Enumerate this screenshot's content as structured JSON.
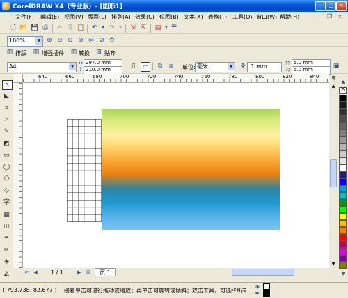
{
  "window": {
    "title": "CorelDRAW X4（专业版）- [图形1]"
  },
  "menu": [
    "文件(F)",
    "编辑(E)",
    "视图(V)",
    "版面(L)",
    "排列(A)",
    "效果(C)",
    "位图(B)",
    "文本(X)",
    "表格(T)",
    "工具(O)",
    "窗口(W)",
    "帮助(H)"
  ],
  "zoom": {
    "value": "100%"
  },
  "toolbar3": {
    "layout_label": "排版",
    "enhance_label": "增强插件",
    "convert_label": "转换",
    "align_label": "贴齐"
  },
  "property_bar": {
    "paper": "A4",
    "width": "297.0 mm",
    "height": "210.0 mm",
    "units_label": "单位:",
    "units_value": "毫米",
    "nudge": ".1 mm",
    "dup_x": "5.0 mm",
    "dup_y": "5.0 mm"
  },
  "ruler": {
    "h_ticks": [
      "640",
      "660",
      "680",
      "700",
      "720",
      "740",
      "760",
      "780",
      "800",
      "820",
      "840"
    ],
    "unit": "毫米"
  },
  "page_nav": {
    "counter": "1 / 1",
    "tab": "页 1"
  },
  "status": {
    "coords": "( 793.738, 82.677 )",
    "hint": "接着单击可进行拖动或缩放；再单击可旋转或倾斜；双击工具，可选择所有对象；按住 Shi..."
  },
  "colors": {
    "gradient": [
      "#a9d25a",
      "#fff2a0",
      "#f7a432",
      "#e98212",
      "#2d84a3",
      "#1e9ad0",
      "#78c4f4"
    ],
    "palette": [
      "#ffffff",
      "#000000",
      "#1a1a1a",
      "#333333",
      "#4d4d4d",
      "#666666",
      "#808080",
      "#999999",
      "#b3b3b3",
      "#cccccc",
      "#e6e6e6",
      "#ffffff",
      "#1f1a8c",
      "#0000ff",
      "#00a0e0",
      "#00c0c0",
      "#00a000",
      "#00ff00",
      "#ffff00",
      "#ffc000",
      "#ff8000",
      "#ff0000",
      "#c00060",
      "#e000e0",
      "#8000a0",
      "#808000"
    ]
  }
}
